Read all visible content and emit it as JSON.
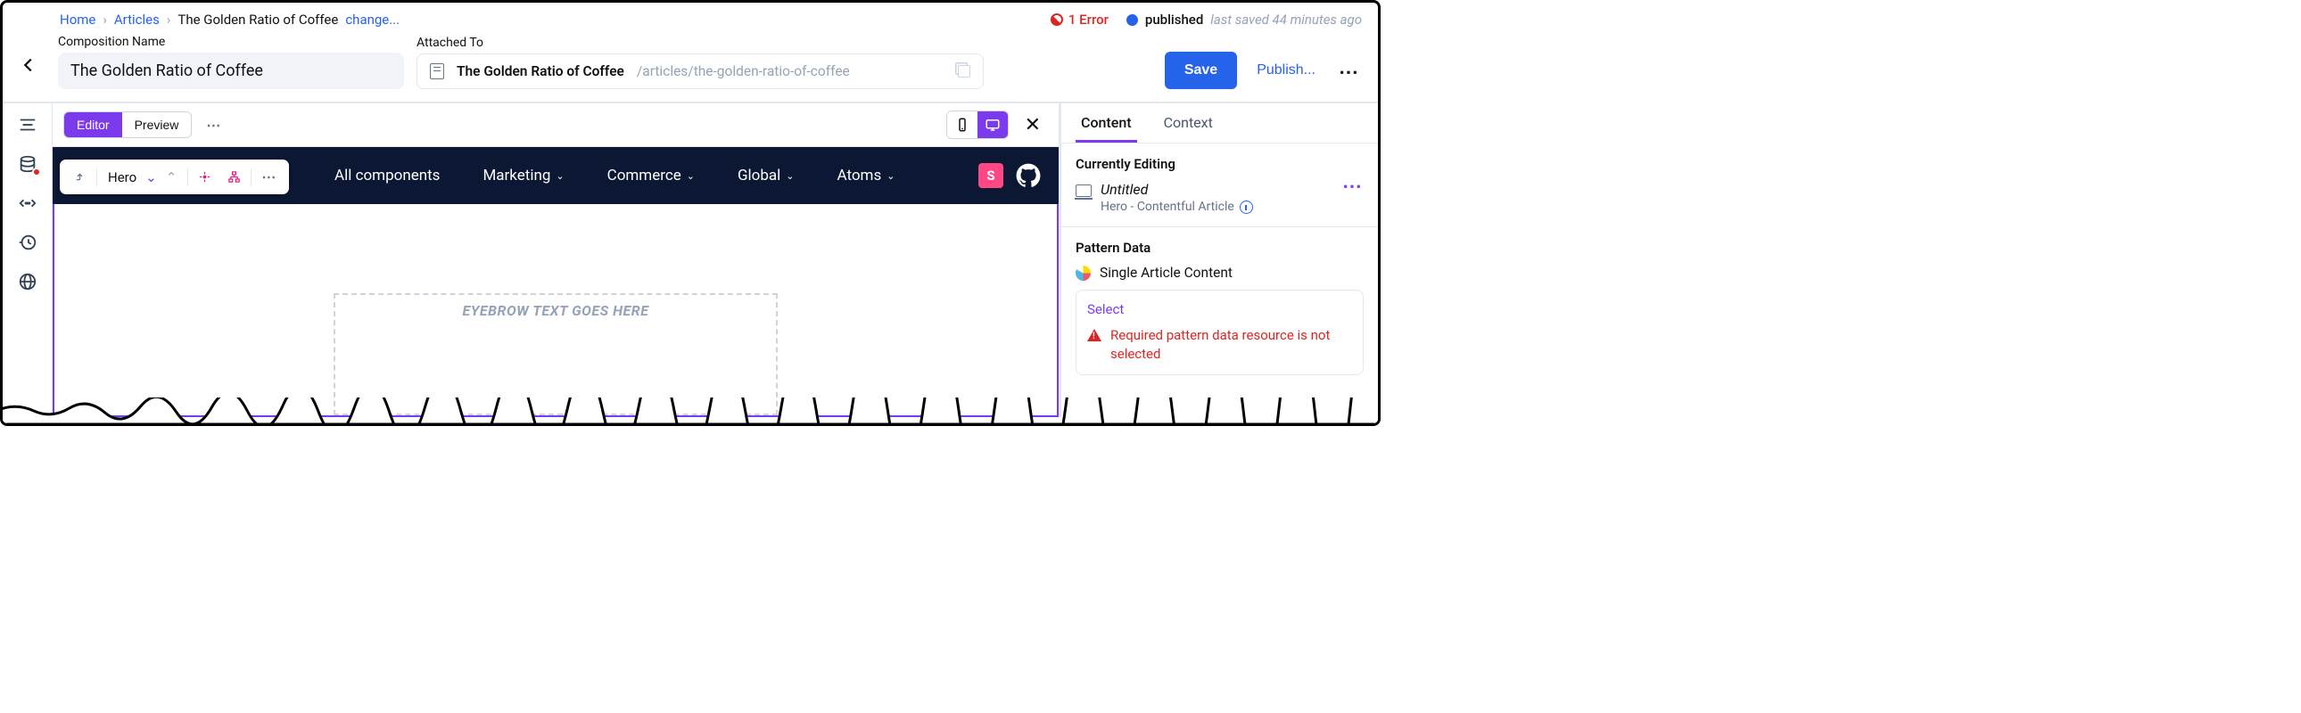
{
  "breadcrumb": {
    "home": "Home",
    "articles": "Articles",
    "current": "The Golden Ratio of Coffee",
    "change": "change..."
  },
  "status": {
    "error_label": "1 Error",
    "published_label": "published",
    "last_saved": "last saved 44 minutes ago"
  },
  "header": {
    "composition_name_label": "Composition Name",
    "composition_name_value": "The Golden Ratio of Coffee",
    "attached_to_label": "Attached To",
    "attached_title": "The Golden Ratio of Coffee",
    "attached_path": "/articles/the-golden-ratio-of-coffee",
    "save_label": "Save",
    "publish_label": "Publish..."
  },
  "toolbar": {
    "editor_label": "Editor",
    "preview_label": "Preview"
  },
  "inline_toolbar": {
    "selected_label": "Hero"
  },
  "site_nav": {
    "items": [
      {
        "label": "All components",
        "has_dropdown": false
      },
      {
        "label": "Marketing",
        "has_dropdown": true
      },
      {
        "label": "Commerce",
        "has_dropdown": true
      },
      {
        "label": "Global",
        "has_dropdown": true
      },
      {
        "label": "Atoms",
        "has_dropdown": true
      }
    ]
  },
  "canvas": {
    "eyebrow_placeholder": "EYEBROW TEXT GOES HERE"
  },
  "right_panel": {
    "tabs": {
      "content": "Content",
      "context": "Context"
    },
    "currently_editing_heading": "Currently Editing",
    "ce_title": "Untitled",
    "ce_subtitle": "Hero - Contentful Article",
    "pattern_data_heading": "Pattern Data",
    "pattern_data_title": "Single Article Content",
    "select_label": "Select",
    "error_message": "Required pattern data resource is not selected"
  }
}
